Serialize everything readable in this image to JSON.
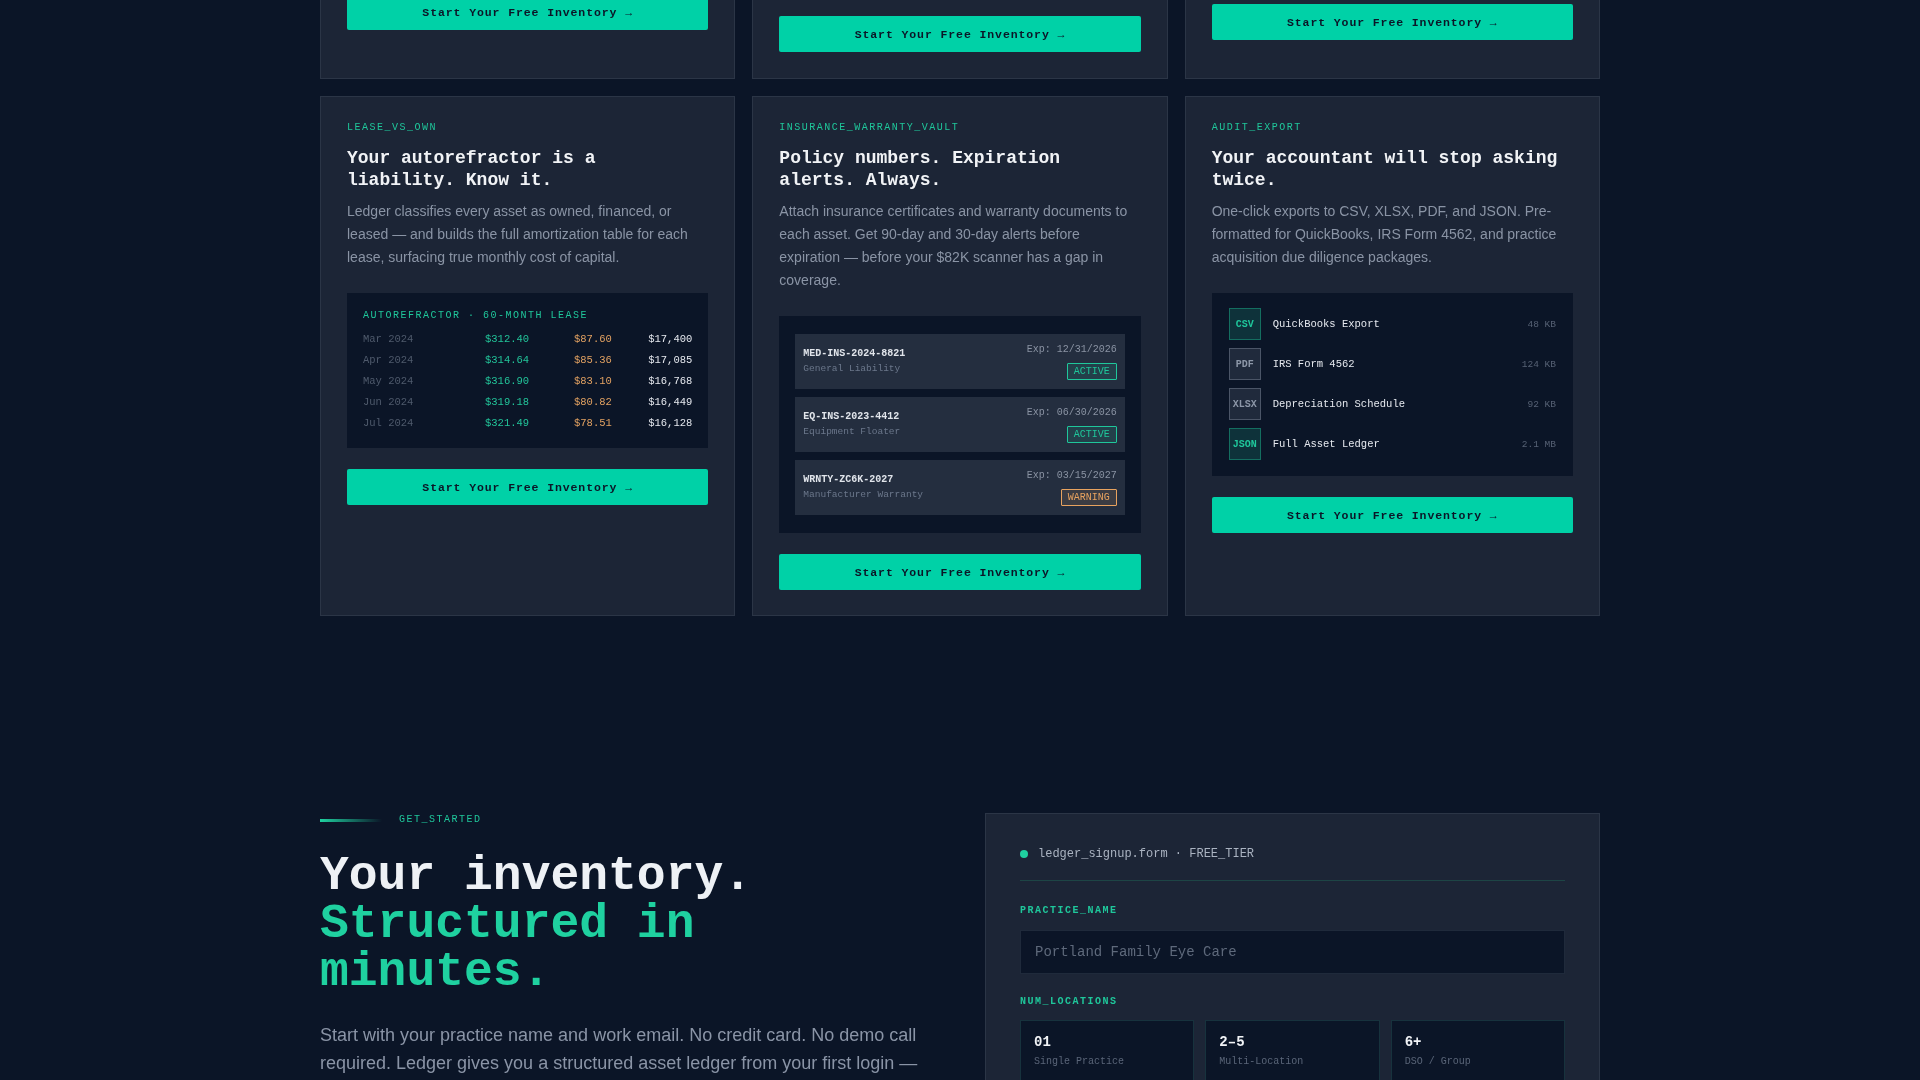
{
  "feature_cards_top": [
    {
      "cta": "Start Your Free Inventory →"
    },
    {
      "cta": "Start Your Free Inventory →"
    },
    {
      "cta": "Start Your Free Inventory →"
    }
  ],
  "feature_cards": [
    {
      "kind": "lease_table",
      "eyebrow": "LEASE_VS_OWN",
      "title": "Your autorefractor is a liability. Know it.",
      "description": "Ledger classifies every asset as owned, financed, or leased — and builds the full amortization table for each lease, surfacing true monthly cost of capital.",
      "panel": {
        "title": "AUTOREFRACTOR · 60-MONTH LEASE",
        "rows": [
          {
            "month": "Mar 2024",
            "column_2": "$312.40",
            "column_3": "$87.60",
            "column_4": "$17,400"
          },
          {
            "month": "Apr 2024",
            "column_2": "$314.64",
            "column_3": "$85.36",
            "column_4": "$17,085"
          },
          {
            "month": "May 2024",
            "column_2": "$316.90",
            "column_3": "$83.10",
            "column_4": "$16,768"
          },
          {
            "month": "Jun 2024",
            "column_2": "$319.18",
            "column_3": "$80.82",
            "column_4": "$16,449"
          },
          {
            "month": "Jul 2024",
            "column_2": "$321.49",
            "column_3": "$78.51",
            "column_4": "$16,128"
          }
        ]
      },
      "cta": "Start Your Free Inventory →"
    },
    {
      "kind": "policy_list",
      "eyebrow": "INSURANCE_WARRANTY_VAULT",
      "title": "Policy numbers. Expiration alerts. Always.",
      "description": "Attach insurance certificates and warranty documents to each asset. Get 90-day and 30-day alerts before expiration — before your $82K scanner has a gap in coverage.",
      "panel": {
        "policies": [
          {
            "number": "MED-INS-2024-8821",
            "type": "General Liability",
            "expires": "Exp: 12/31/2026",
            "status": "ACTIVE",
            "color": "#1fc79b"
          },
          {
            "number": "EQ-INS-2023-4412",
            "type": "Equipment Floater",
            "expires": "Exp: 06/30/2026",
            "status": "ACTIVE",
            "color": "#1fc79b"
          },
          {
            "number": "WRNTY-ZC6K-2027",
            "type": "Manufacturer Warranty",
            "expires": "Exp: 03/15/2027",
            "status": "WARNING",
            "color": "#e8a35f"
          }
        ]
      },
      "cta": "Start Your Free Inventory →"
    },
    {
      "kind": "export_list",
      "eyebrow": "AUDIT_EXPORT",
      "title": "Your accountant will stop asking twice.",
      "description": "One-click exports to CSV, XLSX, PDF, and JSON. Pre-formatted for QuickBooks, IRS Form 4562, and practice acquisition due diligence packages.",
      "panel": {
        "files": [
          {
            "format": "CSV",
            "name": "QuickBooks Export",
            "size": "48 KB",
            "color": "#1fc79b"
          },
          {
            "format": "PDF",
            "name": "IRS Form 4562",
            "size": "124 KB",
            "color": "#8d97a8"
          },
          {
            "format": "XLSX",
            "name": "Depreciation Schedule",
            "size": "92 KB",
            "color": "#8d97a8"
          },
          {
            "format": "JSON",
            "name": "Full Asset Ledger",
            "size": "2.1 MB",
            "color": "#1fc79b"
          }
        ]
      },
      "cta": "Start Your Free Inventory →"
    }
  ],
  "get_started": {
    "eyebrow": "GET_STARTED",
    "heading": "Your inventory.",
    "heading_accent": "Structured in minutes.",
    "description": "Start with your practice name and work email. No credit card. No demo call required. Ledger gives you a structured asset ledger from your first login —"
  },
  "signup_form": {
    "title": "ledger_signup.form · FREE_TIER",
    "practice_field": {
      "label": "PRACTICE_NAME",
      "placeholder": "Portland Family Eye Care"
    },
    "locations": {
      "label": "NUM_LOCATIONS",
      "options": [
        {
          "value": "01",
          "caption": "Single Practice",
          "selected": false
        },
        {
          "value": "2–5",
          "caption": "Multi-Location",
          "selected": false
        },
        {
          "value": "6+",
          "caption": "DSO / Group",
          "selected": false
        }
      ]
    }
  }
}
